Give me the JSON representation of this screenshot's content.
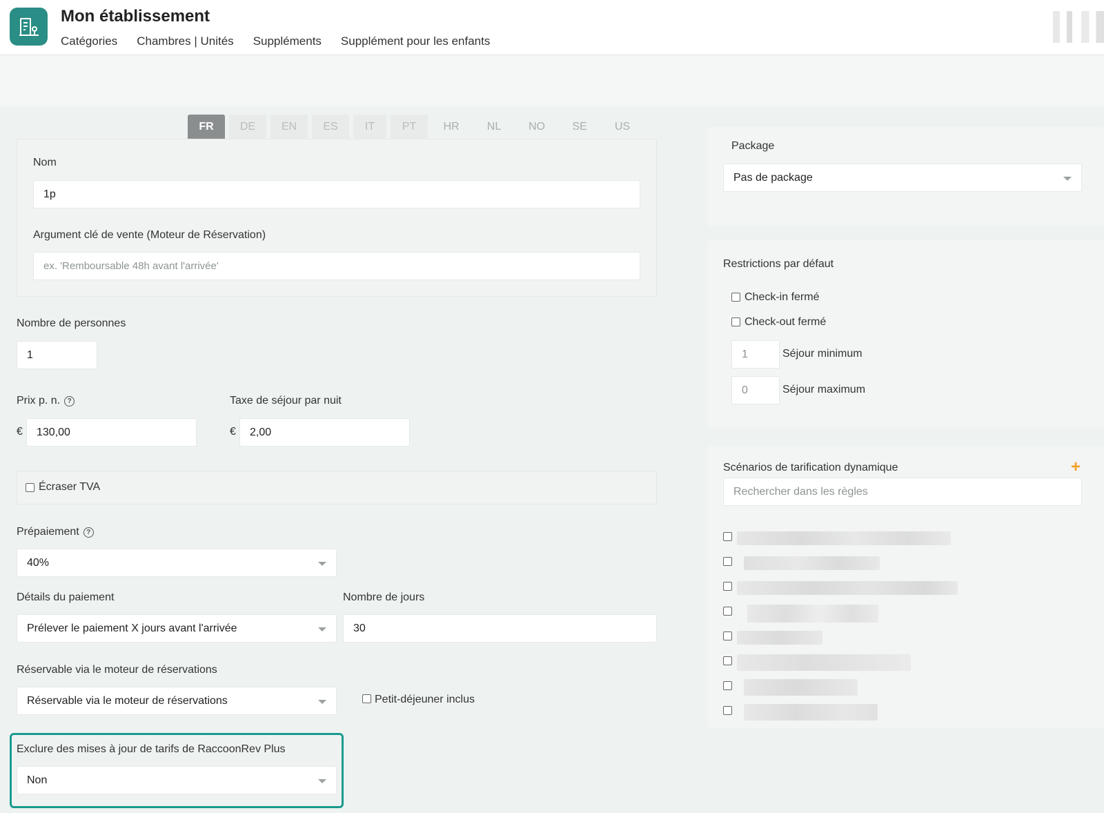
{
  "app": {
    "title": "Mon établissement",
    "nav": [
      "Catégories",
      "Chambres | Unités",
      "Suppléments",
      "Supplément pour les enfants"
    ]
  },
  "languages": [
    {
      "code": "FR",
      "state": "active"
    },
    {
      "code": "DE",
      "state": "disabled"
    },
    {
      "code": "EN",
      "state": "disabled"
    },
    {
      "code": "ES",
      "state": "disabled"
    },
    {
      "code": "IT",
      "state": "disabled"
    },
    {
      "code": "PT",
      "state": "disabled"
    },
    {
      "code": "HR",
      "state": "plain"
    },
    {
      "code": "NL",
      "state": "plain"
    },
    {
      "code": "NO",
      "state": "plain"
    },
    {
      "code": "SE",
      "state": "plain"
    },
    {
      "code": "US",
      "state": "plain"
    }
  ],
  "form": {
    "name_label": "Nom",
    "name_value": "1p",
    "usp_label": "Argument clé de vente (Moteur de Réservation)",
    "usp_placeholder": "ex. 'Remboursable 48h avant l'arrivée'",
    "persons_label": "Nombre de personnes",
    "persons_value": "1",
    "price_label": "Prix p. n.",
    "currency": "€",
    "price_value": "130,00",
    "tax_label": "Taxe de séjour par nuit",
    "tax_value": "2,00",
    "vat_label": "Écraser TVA",
    "prepay_label": "Prépaiement",
    "prepay_value": "40%",
    "payment_details_label": "Détails du paiement",
    "payment_details_value": "Prélever le paiement X jours avant l'arrivée",
    "days_label": "Nombre de jours",
    "days_value": "30",
    "bookable_label": "Réservable via le moteur de réservations",
    "bookable_value": "Réservable via le moteur de réservations",
    "breakfast_label": "Petit-déjeuner inclus",
    "exclude_label": "Exclure des mises à jour de tarifs de RaccoonRev Plus",
    "exclude_value": "Non"
  },
  "sidebar": {
    "package_label": "Package",
    "package_value": "Pas de package",
    "restrictions_title": "Restrictions par défaut",
    "checkin_label": "Check-in fermé",
    "checkout_label": "Check-out fermé",
    "min_stay_value": "1",
    "min_stay_label": "Séjour minimum",
    "max_stay_value": "0",
    "max_stay_label": "Séjour maximum",
    "pricing_title": "Scénarios de tarification dynamique",
    "pricing_search_placeholder": "Rechercher dans les règles",
    "add_symbol": "+"
  },
  "colors": {
    "brand": "#2a8d86",
    "highlight": "#1a9a8f",
    "accent": "#f0a12a"
  }
}
